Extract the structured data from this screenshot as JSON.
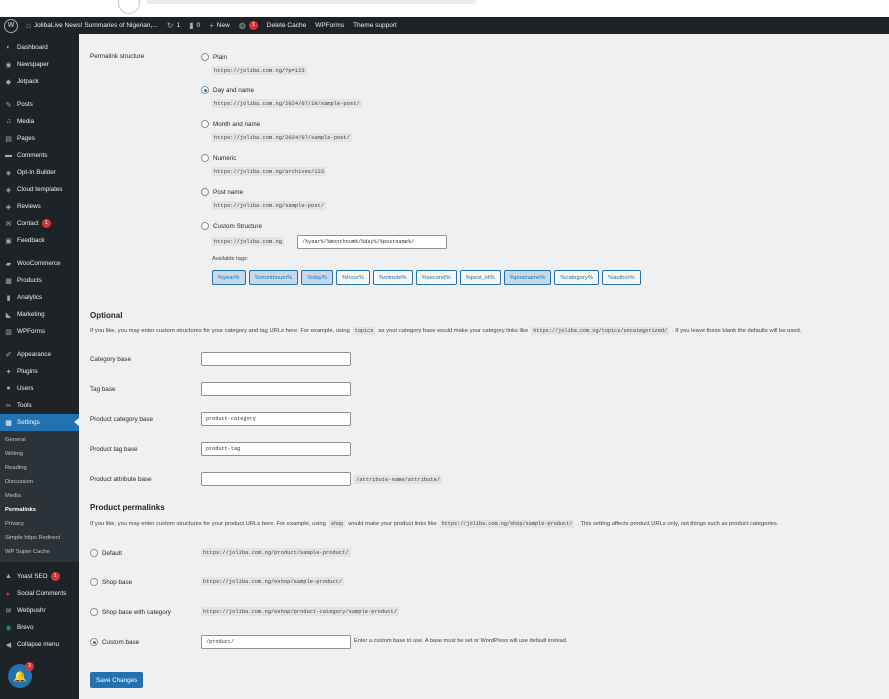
{
  "admin_bar": {
    "site_title": "JolibaLive News! Summaries of Nigerian,...",
    "comments_count": "1",
    "pending_count": "0",
    "new_label": "New",
    "plugin_badge": "1",
    "delete_cache": "Delete Cache",
    "wpforms": "WPForms",
    "theme_support": "Theme support"
  },
  "sidebar": {
    "dashboard": "Dashboard",
    "newspaper": "Newspaper",
    "jetpack": "Jetpack",
    "posts": "Posts",
    "media": "Media",
    "pages": "Pages",
    "comments": "Comments",
    "optin": "Opt-In Builder",
    "cloud_templates": "Cloud templates",
    "reviews": "Reviews",
    "contact": "Contact",
    "contact_badge": "1",
    "feedback": "Feedback",
    "woocommerce": "WooCommerce",
    "products": "Products",
    "analytics": "Analytics",
    "marketing": "Marketing",
    "wpforms": "WPForms",
    "appearance": "Appearance",
    "plugins": "Plugins",
    "users": "Users",
    "tools": "Tools",
    "settings": "Settings",
    "sub": {
      "general": "General",
      "writing": "Writing",
      "reading": "Reading",
      "discussion": "Discussion",
      "media": "Media",
      "permalinks": "Permalinks",
      "privacy": "Privacy",
      "simple_https": "Simple https Redirect",
      "wp_super_cache": "WP Super Cache"
    },
    "yoast": "Yoast SEO",
    "yoast_badge": "1",
    "social_comments": "Social Comments",
    "webpushr": "Webpushr",
    "brevo": "Brevo",
    "collapse": "Collapse menu",
    "notif_badge": "3"
  },
  "permalink": {
    "label": "Permalink structure",
    "plain": "Plain",
    "plain_url": "https://joliba.com.ng/?p=123",
    "day_name": "Day and name",
    "day_name_url": "https://joliba.com.ng/2024/07/18/sample-post/",
    "month_name": "Month and name",
    "month_name_url": "https://joliba.com.ng/2024/07/sample-post/",
    "numeric": "Numeric",
    "numeric_url": "https://joliba.com.ng/archives/123",
    "post_name": "Post name",
    "post_name_url": "https://joliba.com.ng/sample-post/",
    "custom": "Custom Structure",
    "custom_prefix": "https://joliba.com.ng",
    "custom_value": "/%year%/%monthnum%/%day%/%postname%/",
    "available_tags": "Available tags:",
    "tags": {
      "year": "%year%",
      "monthnum": "%monthnum%",
      "day": "%day%",
      "hour": "%hour%",
      "minute": "%minute%",
      "second": "%second%",
      "post_id": "%post_id%",
      "postname": "%postname%",
      "category": "%category%",
      "author": "%author%"
    }
  },
  "optional": {
    "heading": "Optional",
    "text_before": "If you like, you may enter custom structures for your category and tag URLs here. For example, using",
    "code_topics": "topics",
    "text_mid": "as your category base would make your category links like",
    "code_url": "https://joliba.com.ng/topics/uncategorized/",
    "text_after": ". If you leave these blank the defaults will be used.",
    "category_base": "Category base",
    "tag_base": "Tag base",
    "product_category_base": "Product category base",
    "product_category_value": "product-category",
    "product_tag_base": "Product tag base",
    "product_tag_value": "product-tag",
    "product_attribute_base": "Product attribute base",
    "attribute_suffix": "/attribute-name/attribute/"
  },
  "product": {
    "heading": "Product permalinks",
    "text_before": "If you like, you may enter custom structures for your product URLs here. For example, using",
    "code_shop": "shop",
    "text_mid": "would make your product links like",
    "code_url": "https://joliba.com.ng/shop/sample-product/",
    "text_after": ". This setting affects product URLs only, not things such as product categories.",
    "default": "Default",
    "default_url": "https://joliba.com.ng/product/sample-product/",
    "shop_base": "Shop base",
    "shop_base_url": "https://joliba.com.ng/eshop/sample-product/",
    "shop_base_cat": "Shop base with category",
    "shop_base_cat_url": "https://joliba.com.ng/eshop/product-category/sample-product/",
    "custom_base": "Custom base",
    "custom_value": "/product/",
    "custom_hint": "Enter a custom base to use. A base must be set or WordPress will use default instead."
  },
  "save_button": "Save Changes"
}
